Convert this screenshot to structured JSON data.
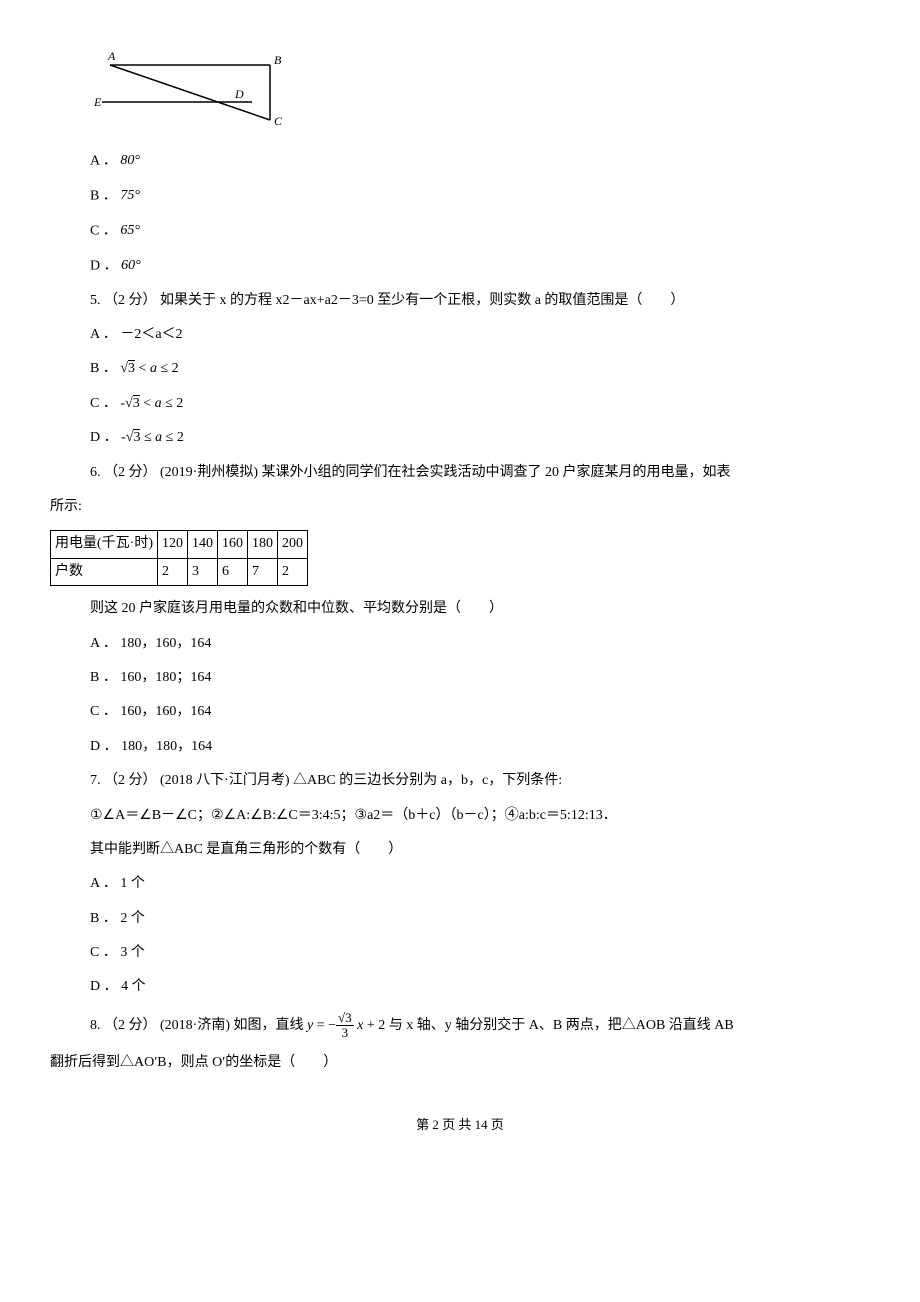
{
  "figure": {
    "labels": {
      "A": "A",
      "B": "B",
      "C": "C",
      "D": "D",
      "E": "E"
    }
  },
  "q4_options": {
    "A_label": "A ．",
    "A_text": "80°",
    "B_label": "B ．",
    "B_text": "75°",
    "C_label": "C ．",
    "C_text": "65°",
    "D_label": "D ．",
    "D_text": "60°"
  },
  "q5": {
    "stem": "5. （2 分）  如果关于 x 的方程 x2－ax+a2－3=0 至少有一个正根，则实数 a 的取值范围是（　　）",
    "A_label": "A ．",
    "A_text": "－2＜a＜2",
    "B_label": "B ．",
    "C_label": "C ．",
    "D_label": "D ．"
  },
  "q6": {
    "stem_line1": "6. （2 分） (2019·荆州模拟) 某课外小组的同学们在社会实践活动中调查了 20 户家庭某月的用电量，如表",
    "stem_line2": "所示:",
    "table": {
      "header": [
        "用电量(千瓦·时)",
        "120",
        "140",
        "160",
        "180",
        "200"
      ],
      "row": [
        "户数",
        "2",
        "3",
        "6",
        "7",
        "2"
      ]
    },
    "followup": "则这 20 户家庭该月用电量的众数和中位数、平均数分别是（　　）",
    "A": "A ． 180，160，164",
    "B": "B ． 160，180；164",
    "C": "C ． 160，160，164",
    "D": "D ． 180，180，164"
  },
  "q7": {
    "stem": "7. （2 分） (2018 八下·江门月考) △ABC 的三边长分别为 a，b，c，下列条件:",
    "conditions": "①∠A＝∠B－∠C；②∠A:∠B:∠C＝3:4:5；③a2＝（b＋c）（b－c）；④a:b:c＝5:12:13．",
    "ask": "其中能判断△ABC 是直角三角形的个数有（　　）",
    "A": "A ． 1 个",
    "B": "B ． 2 个",
    "C": "C ． 3 个",
    "D": "D ． 4 个"
  },
  "q8": {
    "pre": "8. （2 分） (2018·济南) 如图，直线 ",
    "post": " 与 x 轴、y 轴分别交于 A、B 两点，把△AOB 沿直线 AB",
    "line2": "翻折后得到△AO′B，则点 O′的坐标是（　　）"
  },
  "footer": "第 2 页 共 14 页"
}
